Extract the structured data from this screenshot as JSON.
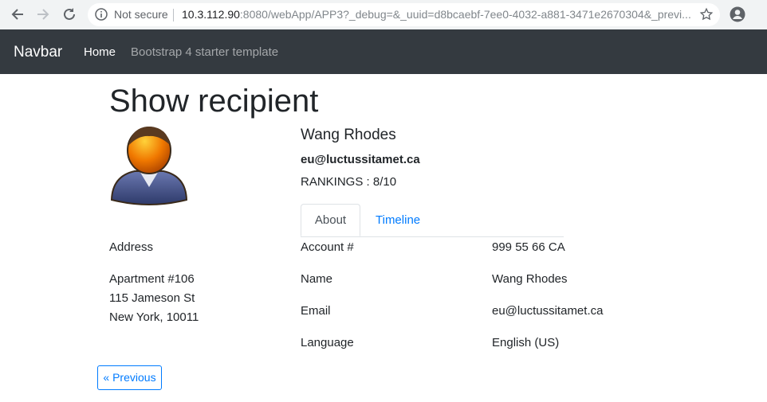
{
  "browser": {
    "security_label": "Not secure",
    "url_host": "10.3.112.90",
    "url_rest": ":8080/webApp/APP3?_debug=&_uuid=d8bcaebf-7ee0-4032-a881-3471e2670304&_previ..."
  },
  "navbar": {
    "brand": "Navbar",
    "links": [
      "Home",
      "Bootstrap 4 starter template"
    ]
  },
  "page": {
    "title": "Show recipient"
  },
  "recipient": {
    "name": "Wang Rhodes",
    "email": "eu@luctussitamet.ca",
    "rankings": "RANKINGS : 8/10"
  },
  "tabs": [
    "About",
    "Timeline"
  ],
  "address": {
    "label": "Address",
    "lines": [
      "Apartment #106",
      "115 Jameson St",
      "New York, 10011"
    ]
  },
  "details": [
    {
      "label": "Account #",
      "value": "999 55 66 CA"
    },
    {
      "label": "Name",
      "value": "Wang Rhodes"
    },
    {
      "label": "Email",
      "value": "eu@luctussitamet.ca"
    },
    {
      "label": "Language",
      "value": "English (US)"
    }
  ],
  "pagination": {
    "previous_label": "« Previous"
  },
  "colors": {
    "navbar_bg": "#343a40",
    "link": "#007bff",
    "avatar_head": "#f07800",
    "avatar_body": "#3b4a80"
  }
}
